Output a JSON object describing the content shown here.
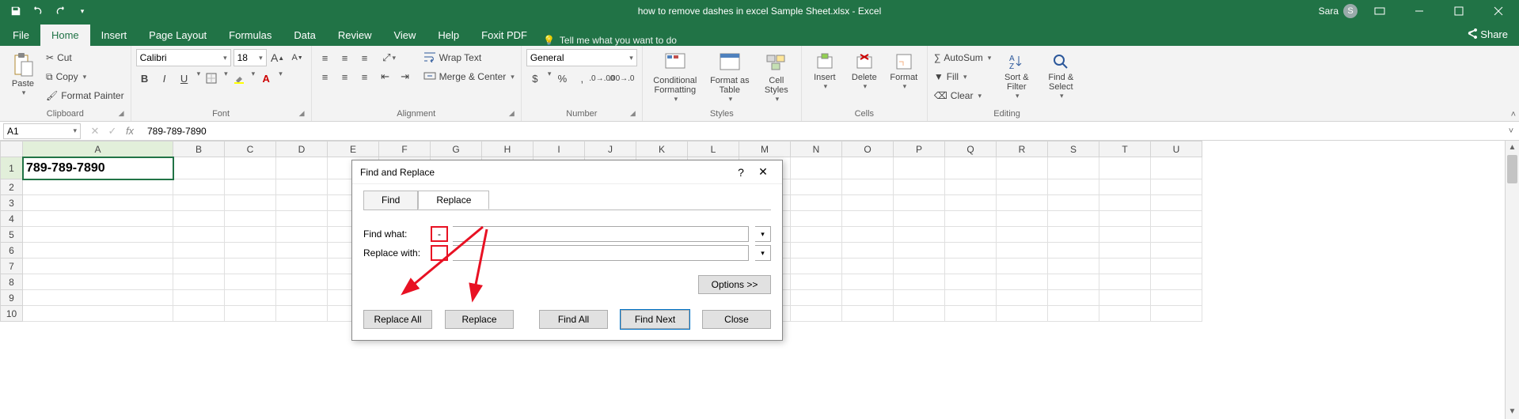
{
  "title": {
    "doc": "how to remove dashes in excel Sample Sheet.xlsx",
    "app": "Excel",
    "combined": "how to remove dashes in excel Sample Sheet.xlsx  -  Excel"
  },
  "user": {
    "name": "Sara",
    "initial": "S"
  },
  "menu": {
    "file": "File",
    "home": "Home",
    "insert": "Insert",
    "pageLayout": "Page Layout",
    "formulas": "Formulas",
    "data": "Data",
    "review": "Review",
    "view": "View",
    "help": "Help",
    "foxit": "Foxit PDF",
    "tellme": "Tell me what you want to do",
    "share": "Share"
  },
  "ribbon": {
    "clipboard": {
      "paste": "Paste",
      "cut": "Cut",
      "copy": "Copy",
      "formatPainter": "Format Painter",
      "label": "Clipboard"
    },
    "font": {
      "name": "Calibri",
      "size": "18",
      "label": "Font"
    },
    "alignment": {
      "wrap": "Wrap Text",
      "merge": "Merge & Center",
      "label": "Alignment"
    },
    "number": {
      "format": "General",
      "label": "Number"
    },
    "styles": {
      "cf": "Conditional Formatting",
      "fat": "Format as Table",
      "cs": "Cell Styles",
      "label": "Styles"
    },
    "cells": {
      "insert": "Insert",
      "delete": "Delete",
      "format": "Format",
      "label": "Cells"
    },
    "editing": {
      "autosum": "AutoSum",
      "fill": "Fill",
      "clear": "Clear",
      "sort": "Sort & Filter",
      "find": "Find & Select",
      "label": "Editing"
    }
  },
  "fbar": {
    "ref": "A1",
    "formula": "789-789-7890"
  },
  "sheet": {
    "cols": [
      "A",
      "B",
      "C",
      "D",
      "E",
      "F",
      "G",
      "H",
      "I",
      "J",
      "K",
      "L",
      "M",
      "N",
      "O",
      "P",
      "Q",
      "R",
      "S",
      "T",
      "U"
    ],
    "rows": [
      1,
      2,
      3,
      4,
      5,
      6,
      7,
      8,
      9,
      10
    ],
    "a1": "789-789-7890"
  },
  "dialog": {
    "title": "Find and Replace",
    "tab_find": "Find",
    "tab_replace": "Replace",
    "findwhat_label": "Find what:",
    "findwhat_value": "-",
    "replacewith_label": "Replace with:",
    "replacewith_value": "",
    "options": "Options >>",
    "replaceAll": "Replace All",
    "replace": "Replace",
    "findAll": "Find All",
    "findNext": "Find Next",
    "close": "Close"
  }
}
